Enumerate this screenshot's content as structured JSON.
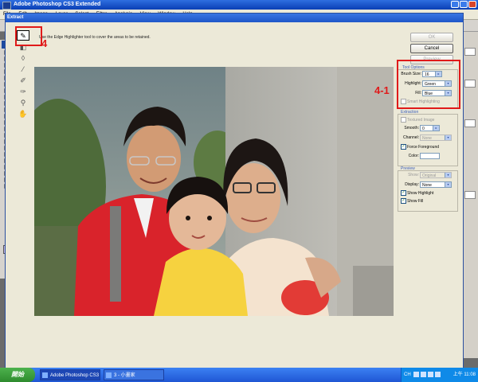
{
  "app": {
    "title": "Adobe Photoshop CS3 Extended",
    "menu": [
      "File",
      "Edit",
      "Image",
      "Layer",
      "Select",
      "Filter",
      "Analysis",
      "View",
      "Window",
      "Help"
    ],
    "ps_logo": "Ps"
  },
  "dialog": {
    "title": "Extract",
    "hint": "Use the Edge Highlighter tool to cover the areas to be retained.",
    "buttons": {
      "ok": "OK",
      "cancel": "Cancel",
      "preview": "Preview"
    },
    "tool_options": {
      "title": "Tool Options",
      "brush_size_label": "Brush Size:",
      "brush_size": "16",
      "highlight_label": "Highlight:",
      "highlight": "Green",
      "fill_label": "Fill:",
      "fill": "Blue",
      "smart_highlighting": "Smart Highlighting"
    },
    "extraction": {
      "title": "Extraction",
      "textured_image": "Textured Image",
      "smooth_label": "Smooth:",
      "smooth": "0",
      "channel_label": "Channel:",
      "channel": "None",
      "force_foreground": "Force Foreground",
      "color_label": "Color:"
    },
    "preview": {
      "title": "Preview",
      "show_label": "Show:",
      "show": "Original",
      "display_label": "Display:",
      "display": "None",
      "show_highlight": "Show Highlight",
      "show_fill": "Show Fill"
    }
  },
  "annotations": {
    "step_tool": "4",
    "step_options": "4-1"
  },
  "taskbar": {
    "start": "開始",
    "tasks": [
      "Adobe Photoshop CS3",
      "3 - 小畫家"
    ],
    "lang": "CH",
    "clock": "上午 11:08"
  },
  "colors": {
    "annotation": "#e01a1a",
    "highlight": "#00ff00",
    "fill": "#0000ff"
  }
}
